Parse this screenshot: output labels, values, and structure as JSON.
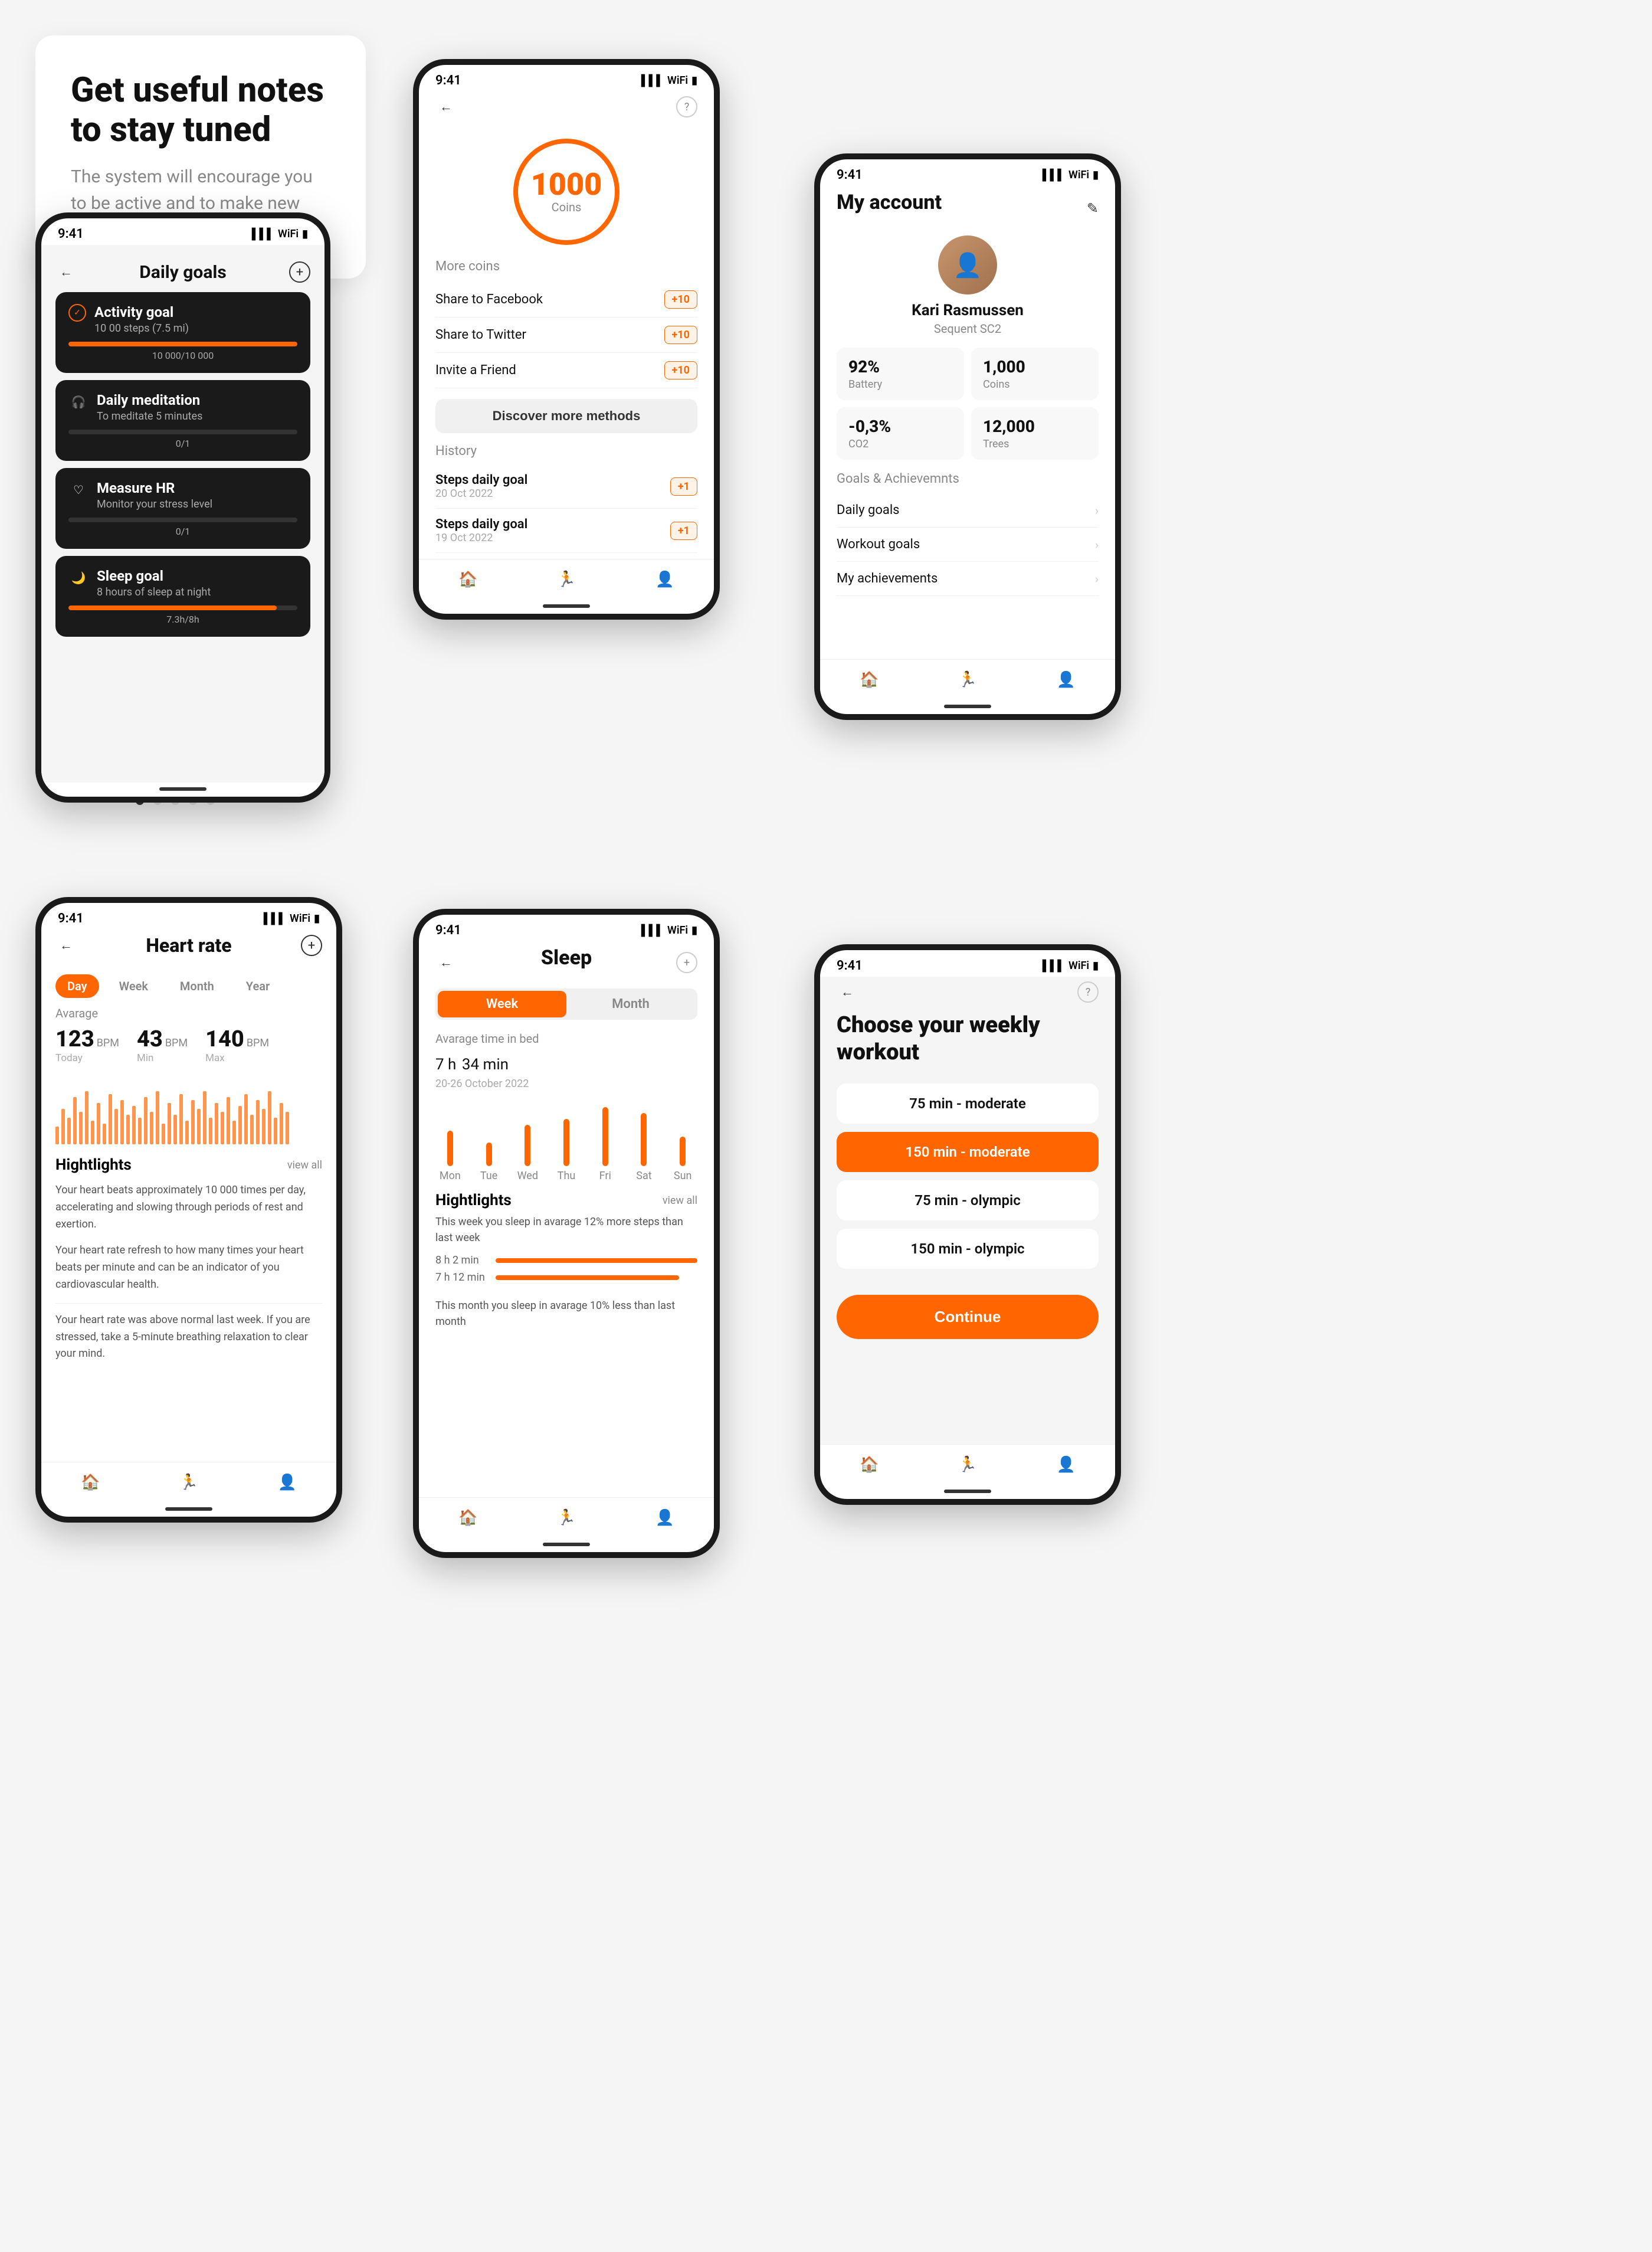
{
  "intro": {
    "title": "Get useful notes to stay tuned",
    "subtitle": "The system will encourage you to be active and to make new records."
  },
  "phone_daily_goals": {
    "status_time": "9:41",
    "title": "Daily goals",
    "back": "←",
    "add": "+",
    "goals": [
      {
        "icon": "✓",
        "name": "Activity goal",
        "desc": "10 00 steps (7.5 mi)",
        "progress": 100,
        "progress_text": "10 000/10 000",
        "checked": true
      },
      {
        "icon": "🎧",
        "name": "Daily meditation",
        "desc": "To meditate 5 minutes",
        "progress": 0,
        "progress_text": "0/1",
        "checked": false
      },
      {
        "icon": "♡",
        "name": "Measure HR",
        "desc": "Monitor your stress level",
        "progress": 0,
        "progress_text": "0/1",
        "checked": false
      },
      {
        "icon": "🌙",
        "name": "Sleep goal",
        "desc": "8 hours of sleep at night",
        "progress": 91,
        "progress_text": "7.3h/8h",
        "checked": false
      }
    ]
  },
  "phone_coins": {
    "status_time": "9:41",
    "coins_value": "1000",
    "coins_label": "Coins",
    "more_coins_title": "More coins",
    "methods": [
      {
        "name": "Share to Facebook",
        "badge": "+10"
      },
      {
        "name": "Share to Twitter",
        "badge": "+10"
      },
      {
        "name": "Invite a Friend",
        "badge": "+10"
      }
    ],
    "discover_btn": "Discover more methods",
    "history_title": "History",
    "history": [
      {
        "name": "Steps daily goal",
        "date": "20 Oct 2022",
        "badge": "+1"
      },
      {
        "name": "Steps daily goal",
        "date": "19 Oct 2022",
        "badge": "+1"
      }
    ]
  },
  "phone_account": {
    "status_time": "9:41",
    "title": "My account",
    "user_name": "Kari Rasmussen",
    "user_device": "Sequent SC2",
    "stats": [
      {
        "value": "92%",
        "label": "Battery"
      },
      {
        "value": "1,000",
        "label": "Coins"
      },
      {
        "value": "-0,3%",
        "label": "CO2"
      },
      {
        "value": "12,000",
        "label": "Trees"
      }
    ],
    "goals_section": "Goals & Achievemnts",
    "goals_items": [
      {
        "name": "Daily goals"
      },
      {
        "name": "Workout goals"
      },
      {
        "name": "My achievements"
      }
    ]
  },
  "phone_heart": {
    "status_time": "9:41",
    "title": "Heart rate",
    "time_tabs": [
      "Day",
      "Week",
      "Month",
      "Year"
    ],
    "active_tab": "Day",
    "avg_label": "Avarage",
    "stats": [
      {
        "value": "123",
        "unit": "BPM",
        "label": "Today"
      },
      {
        "value": "43",
        "unit": "BPM",
        "label": "Min"
      },
      {
        "value": "140",
        "unit": "BPM",
        "label": "Max"
      }
    ],
    "highlights_title": "Hightlights",
    "view_all": "view all",
    "highlight1": "Your heart beats approximately 10 000 times per day, accelerating and slowing through periods of rest and exertion.",
    "highlight2": "Your heart rate refresh to how many times your heart beats per minute and can be an indicator of you cardiovascular health.",
    "highlight3": "Your heart rate was above normal last week. If you are stressed, take a 5-minute breathing relaxation to clear your mind."
  },
  "phone_sleep": {
    "status_time": "9:41",
    "title": "Sleep",
    "tabs": [
      "Week",
      "Month"
    ],
    "active_tab": "Week",
    "avg_bed_label": "Avarage time in bed",
    "avg_hours": "7 h",
    "avg_mins": "34 min",
    "date_range": "20-26 October 2022",
    "days": [
      "Mon",
      "Tue",
      "Wed",
      "Thu",
      "Fri",
      "Sat",
      "Sun"
    ],
    "bar_heights": [
      60,
      40,
      70,
      80,
      100,
      90,
      50
    ],
    "highlights_title": "Hightlights",
    "view_all": "view all",
    "highlight_text": "This week you sleep in avarage 12% more steps than last week",
    "bar1_label": "8 h 2 min",
    "bar2_label": "7 h 12 min",
    "highlight2_text": "This month you sleep in avarage 10% less than last month"
  },
  "phone_workout": {
    "status_time": "9:41",
    "title": "Choose your weekly workout",
    "back": "←",
    "help": "?",
    "options": [
      {
        "label": "75 min - moderate",
        "active": false
      },
      {
        "label": "150 min - moderate",
        "active": true
      },
      {
        "label": "75 min - olympic",
        "active": false
      },
      {
        "label": "150 min - olympic",
        "active": false
      }
    ],
    "continue_btn": "Continue"
  },
  "nav": {
    "home_icon": "🏠",
    "run_icon": "🏃",
    "profile_icon": "👤"
  }
}
